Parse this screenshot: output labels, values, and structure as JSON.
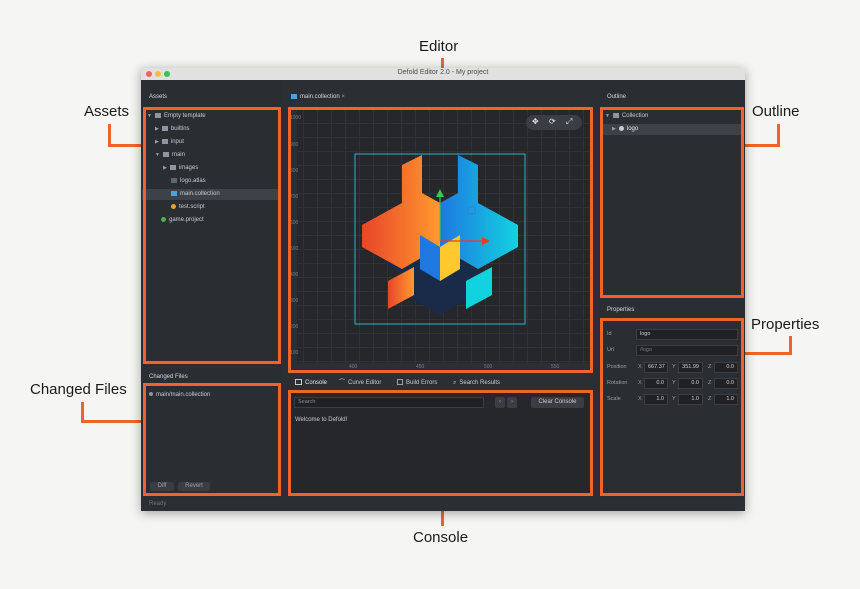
{
  "window": {
    "title": "Defold Editor 2.0 - My project",
    "status": "Ready"
  },
  "callouts": {
    "assets": "Assets",
    "editor": "Editor",
    "outline": "Outline",
    "properties": "Properties",
    "changed_files": "Changed Files",
    "console": "Console"
  },
  "assets": {
    "header": "Assets",
    "items": [
      {
        "label": "Empty template",
        "icon": "folder-icon"
      },
      {
        "label": "builtins",
        "icon": "puzzle-icon"
      },
      {
        "label": "input",
        "icon": "folder-icon"
      },
      {
        "label": "main",
        "icon": "folder-icon"
      },
      {
        "label": "images",
        "icon": "folder-icon"
      },
      {
        "label": "logo.atlas",
        "icon": "atlas-icon"
      },
      {
        "label": "main.collection",
        "icon": "collection-icon"
      },
      {
        "label": "test.script",
        "icon": "script-icon"
      },
      {
        "label": "game.project",
        "icon": "project-icon"
      }
    ]
  },
  "changed_files": {
    "header": "Changed Files",
    "items": [
      "main/main.collection"
    ],
    "diff_label": "Diff",
    "revert_label": "Revert"
  },
  "editor": {
    "tab_label": "main.collection",
    "ruler_y": [
      "1000",
      "900",
      "800",
      "700",
      "600",
      "500",
      "400",
      "300",
      "200",
      "100"
    ],
    "ruler_x": [
      "400",
      "450",
      "500",
      "550"
    ]
  },
  "console": {
    "tabs": [
      "Console",
      "Curve Editor",
      "Build Errors",
      "Search Results"
    ],
    "search_placeholder": "Search",
    "clear_label": "Clear Console",
    "output": "Welcome to Defold!"
  },
  "outline": {
    "header": "Outline",
    "items": [
      "Collection",
      "logo"
    ]
  },
  "properties": {
    "header": "Properties",
    "id_label": "Id",
    "id_value": "logo",
    "url_label": "Url",
    "url_value": "/logo",
    "position_label": "Position",
    "position": [
      "667.37",
      "351.99",
      "0.0"
    ],
    "rotation_label": "Rotation",
    "rotation": [
      "0.0",
      "0.0",
      "0.0"
    ],
    "scale_label": "Scale",
    "scale": [
      "1.0",
      "1.0",
      "1.0"
    ],
    "axis": [
      "X",
      "Y",
      "Z"
    ]
  },
  "colors": {
    "accent": "#f0642a",
    "panel_bg": "#2b2e33",
    "canvas_bg": "#25272b"
  }
}
